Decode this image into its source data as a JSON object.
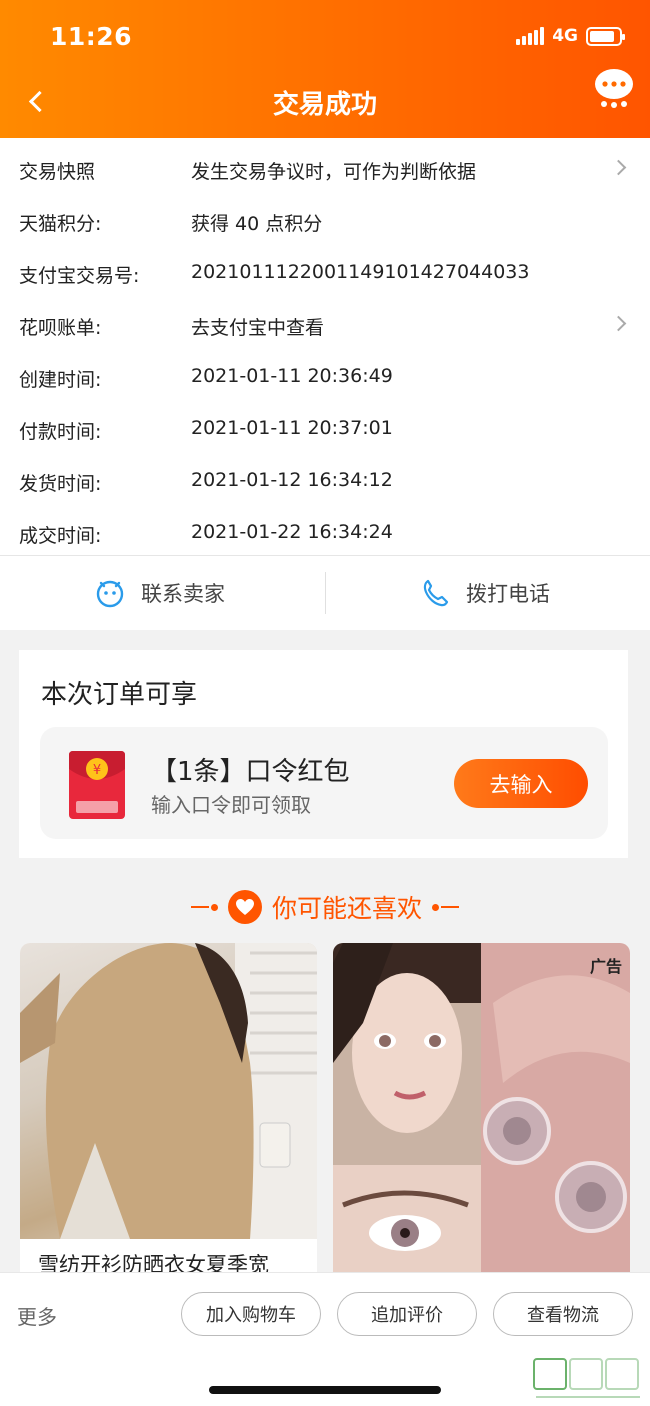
{
  "status_bar": {
    "time": "11:26",
    "network": "4G"
  },
  "header": {
    "title": "交易成功"
  },
  "info_rows": [
    {
      "label": "交易快照",
      "value": "发生交易争议时，可作为判断依据",
      "has_arrow": true
    },
    {
      "label": "天猫积分:",
      "value": "获得 40 点积分",
      "has_arrow": false
    },
    {
      "label": "支付宝交易号:",
      "value": "2021011122001149101427044033",
      "has_arrow": false
    },
    {
      "label": "花呗账单:",
      "value": "去支付宝中查看",
      "has_arrow": true
    },
    {
      "label": "创建时间:",
      "value": "2021-01-11 20:36:49",
      "has_arrow": false
    },
    {
      "label": "付款时间:",
      "value": "2021-01-11 20:37:01",
      "has_arrow": false
    },
    {
      "label": "发货时间:",
      "value": "2021-01-12 16:34:12",
      "has_arrow": false
    },
    {
      "label": "成交时间:",
      "value": "2021-01-22 16:34:24",
      "has_arrow": false
    }
  ],
  "contact": {
    "seller_label": "联系卖家",
    "phone_label": "拨打电话"
  },
  "benefit": {
    "title": "本次订单可享",
    "coupon_name": "【1条】口令红包",
    "coupon_desc": "输入口令即可领取",
    "button_label": "去输入"
  },
  "recommend": {
    "title": "你可能还喜欢",
    "products": [
      {
        "title": "雪纺开衫防晒衣女夏季宽"
      },
      {
        "ad_label": "广告"
      }
    ]
  },
  "bottom_bar": {
    "more_label": "更多",
    "buttons": [
      "加入购物车",
      "追加评价",
      "查看物流"
    ]
  },
  "colors": {
    "brand": "#ff6a00",
    "accent_text": "#ff5500"
  }
}
